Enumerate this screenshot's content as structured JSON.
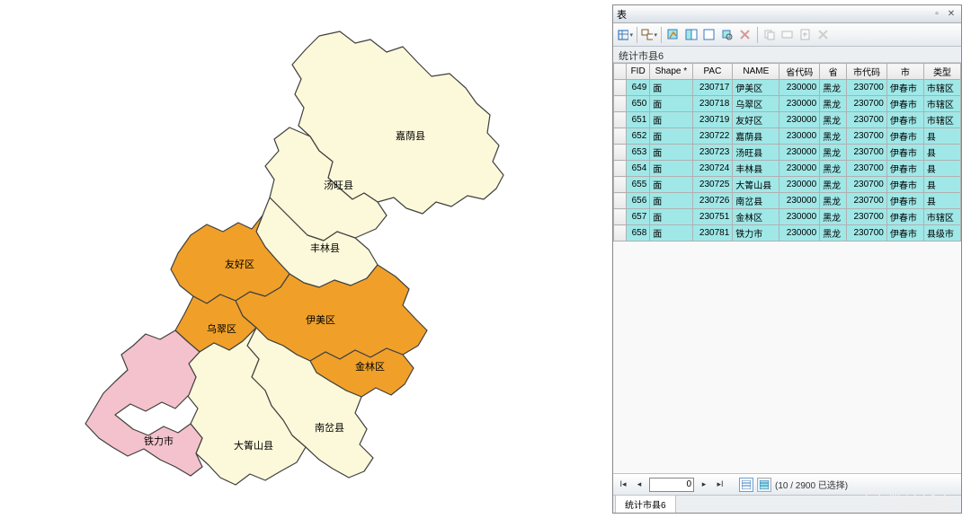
{
  "window": {
    "title": "表"
  },
  "layer_name": "统计市县6",
  "map_labels": {
    "jiayin": "嘉荫县",
    "tangwang": "汤旺县",
    "fenglin": "丰林县",
    "youhao": "友好区",
    "yimei": "伊美区",
    "wucui": "乌翠区",
    "jinlin": "金林区",
    "nancha": "南岔县",
    "tieli": "铁力市",
    "daqingshan": "大箐山县"
  },
  "columns": [
    "FID",
    "Shape *",
    "PAC",
    "NAME",
    "省代码",
    "省",
    "市代码",
    "市",
    "类型"
  ],
  "rows": [
    {
      "fid": "649",
      "shape": "面",
      "pac": "230717",
      "name": "伊美区",
      "pcode": "230000",
      "prov": "黑龙",
      "ccode": "230700",
      "city": "伊春市",
      "type": "市辖区"
    },
    {
      "fid": "650",
      "shape": "面",
      "pac": "230718",
      "name": "乌翠区",
      "pcode": "230000",
      "prov": "黑龙",
      "ccode": "230700",
      "city": "伊春市",
      "type": "市辖区"
    },
    {
      "fid": "651",
      "shape": "面",
      "pac": "230719",
      "name": "友好区",
      "pcode": "230000",
      "prov": "黑龙",
      "ccode": "230700",
      "city": "伊春市",
      "type": "市辖区"
    },
    {
      "fid": "652",
      "shape": "面",
      "pac": "230722",
      "name": "嘉荫县",
      "pcode": "230000",
      "prov": "黑龙",
      "ccode": "230700",
      "city": "伊春市",
      "type": "县"
    },
    {
      "fid": "653",
      "shape": "面",
      "pac": "230723",
      "name": "汤旺县",
      "pcode": "230000",
      "prov": "黑龙",
      "ccode": "230700",
      "city": "伊春市",
      "type": "县"
    },
    {
      "fid": "654",
      "shape": "面",
      "pac": "230724",
      "name": "丰林县",
      "pcode": "230000",
      "prov": "黑龙",
      "ccode": "230700",
      "city": "伊春市",
      "type": "县"
    },
    {
      "fid": "655",
      "shape": "面",
      "pac": "230725",
      "name": "大箐山县",
      "pcode": "230000",
      "prov": "黑龙",
      "ccode": "230700",
      "city": "伊春市",
      "type": "县"
    },
    {
      "fid": "656",
      "shape": "面",
      "pac": "230726",
      "name": "南岔县",
      "pcode": "230000",
      "prov": "黑龙",
      "ccode": "230700",
      "city": "伊春市",
      "type": "县"
    },
    {
      "fid": "657",
      "shape": "面",
      "pac": "230751",
      "name": "金林区",
      "pcode": "230000",
      "prov": "黑龙",
      "ccode": "230700",
      "city": "伊春市",
      "type": "市辖区"
    },
    {
      "fid": "658",
      "shape": "面",
      "pac": "230781",
      "name": "铁力市",
      "pcode": "230000",
      "prov": "黑龙",
      "ccode": "230700",
      "city": "伊春市",
      "type": "县级市"
    }
  ],
  "nav": {
    "current": "0",
    "selection": "(10 / 2900 已选择)"
  },
  "tab": "统计市县6",
  "watermark": "数读城事",
  "colors": {
    "pale": "#fcf9da",
    "orange": "#f0a029",
    "pink": "#f4c2cc",
    "stroke": "#404040"
  }
}
